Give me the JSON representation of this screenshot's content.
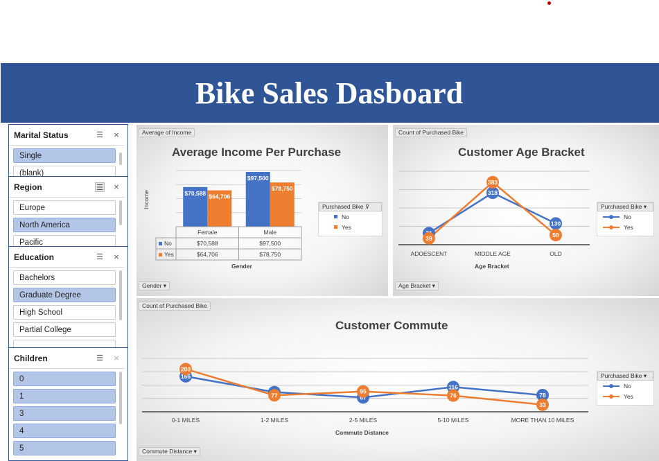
{
  "dashboard": {
    "title": "Bike Sales Dasboard"
  },
  "slicers": {
    "marital": {
      "title": "Marital Status",
      "items": [
        "Single",
        "(blank)"
      ],
      "selected": [
        0
      ]
    },
    "region": {
      "title": "Region",
      "items": [
        "Europe",
        "North America",
        "Pacific"
      ],
      "selected": [
        1
      ]
    },
    "education": {
      "title": "Education",
      "items": [
        "Bachelors",
        "Graduate Degree",
        "High School",
        "Partial College"
      ],
      "selected": [
        1
      ]
    },
    "children": {
      "title": "Children",
      "items": [
        "0",
        "1",
        "3",
        "4",
        "5"
      ],
      "selected": [
        0,
        1,
        2,
        3,
        4
      ]
    }
  },
  "charts": {
    "income": {
      "value_field": "Average of Income",
      "axis_field": "Gender",
      "legend_field": "Purchased Bike",
      "chart_data": {
        "type": "bar",
        "title": "Average Income Per Purchase",
        "xlabel": "Gender",
        "ylabel": "Income",
        "categories": [
          "Female",
          "Male"
        ],
        "series": [
          {
            "name": "No",
            "values": [
              70588,
              97500
            ],
            "labels": [
              "$70,588",
              "$97,500"
            ],
            "color": "#4472c4"
          },
          {
            "name": "Yes",
            "values": [
              64706,
              78750
            ],
            "labels": [
              "$64,706",
              "$78,750"
            ],
            "color": "#ed7d31"
          }
        ],
        "ylim": [
          0,
          100000
        ],
        "table": true
      }
    },
    "age": {
      "value_field": "Count of Purchased Bike",
      "axis_field": "Age Bracket",
      "legend_field": "Purchased Bike",
      "chart_data": {
        "type": "line",
        "title": "Customer Age Bracket",
        "xlabel": "Age Bracket",
        "categories": [
          "ADOESCENT",
          "MIDDLE AGE",
          "OLD"
        ],
        "series": [
          {
            "name": "No",
            "values": [
              71,
              318,
              130
            ],
            "color": "#4472c4"
          },
          {
            "name": "Yes",
            "values": [
              39,
              383,
              59
            ],
            "color": "#ed7d31"
          }
        ],
        "ylim": [
          0,
          450
        ]
      }
    },
    "commute": {
      "value_field": "Count of Purchased Bike",
      "axis_field": "Commute Distance",
      "legend_field": "Purchased Bike",
      "chart_data": {
        "type": "line",
        "title": "Customer Commute",
        "xlabel": "Commute Distance",
        "categories": [
          "0-1 MILES",
          "1-2 MILES",
          "2-5 MILES",
          "5-10 MILES",
          "MORE THAN 10 MILES"
        ],
        "series": [
          {
            "name": "No",
            "values": [
              166,
              92,
              67,
              116,
              78
            ],
            "color": "#4472c4"
          },
          {
            "name": "Yes",
            "values": [
              200,
              77,
              95,
              76,
              33
            ],
            "color": "#ed7d31"
          }
        ],
        "ylim": [
          0,
          250
        ]
      }
    }
  }
}
